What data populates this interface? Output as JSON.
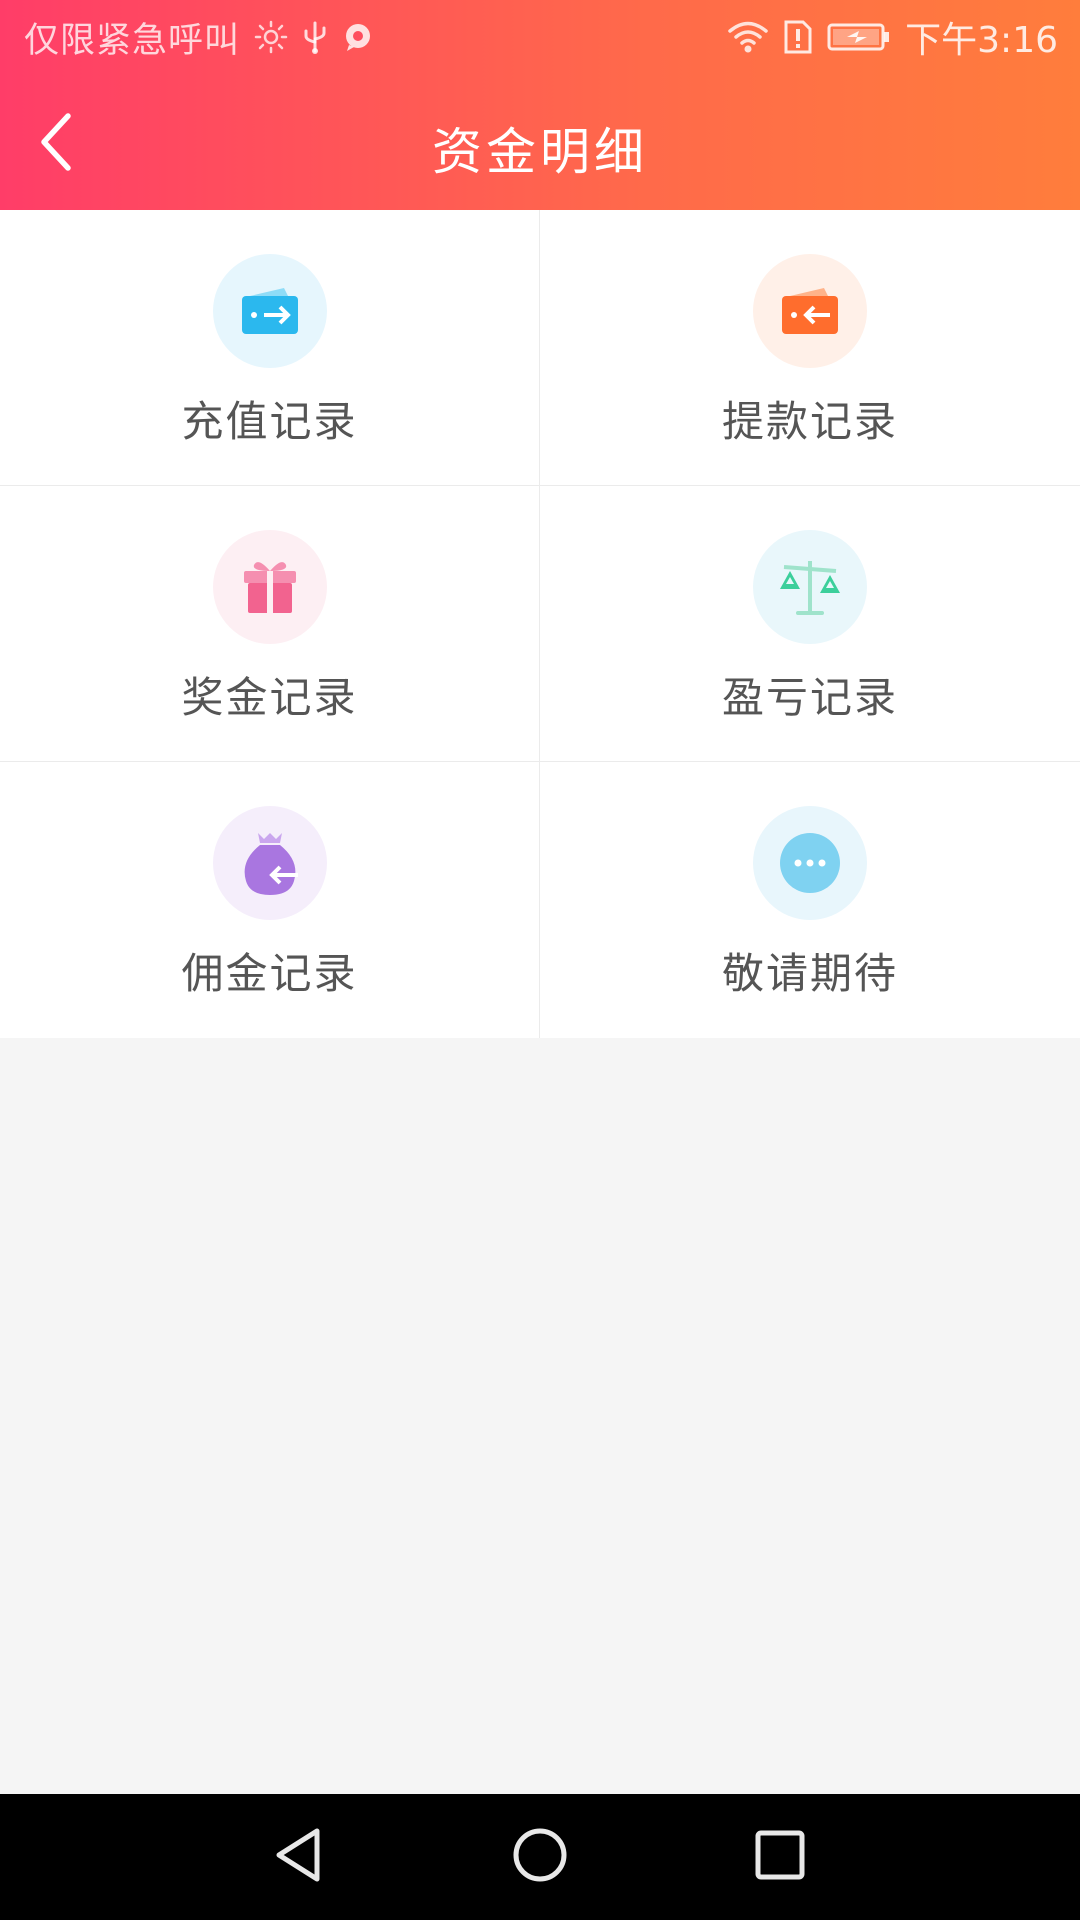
{
  "status_bar": {
    "carrier": "仅限紧急呼叫",
    "time": "下午3:16"
  },
  "header": {
    "title": "资金明细"
  },
  "menu": [
    {
      "label": "充值记录",
      "icon": "wallet-in-icon",
      "bg": "#e6f6fd",
      "color": "#2bb8ee"
    },
    {
      "label": "提款记录",
      "icon": "wallet-out-icon",
      "bg": "#fff0e8",
      "color": "#ff6d2d"
    },
    {
      "label": "奖金记录",
      "icon": "gift-icon",
      "bg": "#fdeff3",
      "color": "#f2638f"
    },
    {
      "label": "盈亏记录",
      "icon": "balance-scale-icon",
      "bg": "#e9f7fb",
      "color": "#3ccf9b"
    },
    {
      "label": "佣金记录",
      "icon": "money-bag-icon",
      "bg": "#f5eefb",
      "color": "#a976e0"
    },
    {
      "label": "敬请期待",
      "icon": "more-icon",
      "bg": "#e8f6fc",
      "color": "#7fd2f1"
    }
  ],
  "colors": {
    "header_gradient_start": "#ff3d68",
    "header_gradient_end": "#ff7d3c",
    "page_background": "#f5f5f5",
    "nav_bar": "#000000"
  }
}
